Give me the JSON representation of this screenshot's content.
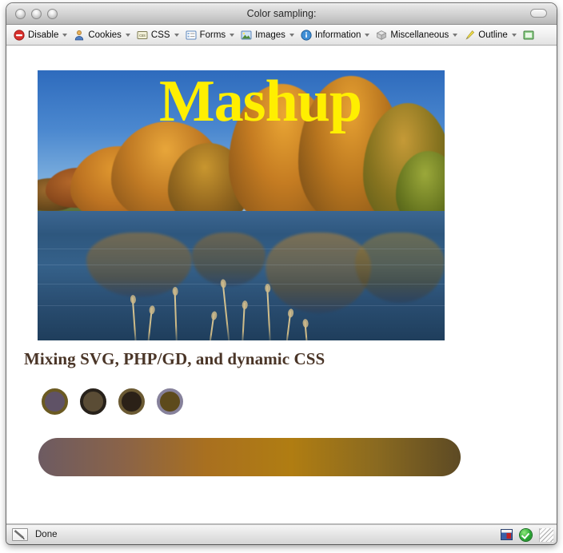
{
  "window": {
    "title": "Color sampling:",
    "traffic_lights": [
      "close-button",
      "minimize-button",
      "zoom-button"
    ],
    "toolbar_pill_name": "toolbar-toggle-pill"
  },
  "devbar": {
    "items": [
      {
        "label": "Disable",
        "icon": "disable-icon",
        "has_caret": true
      },
      {
        "label": "Cookies",
        "icon": "cookies-icon",
        "has_caret": true
      },
      {
        "label": "CSS",
        "icon": "css-icon",
        "has_caret": true
      },
      {
        "label": "Forms",
        "icon": "forms-icon",
        "has_caret": true
      },
      {
        "label": "Images",
        "icon": "images-icon",
        "has_caret": true
      },
      {
        "label": "Information",
        "icon": "information-icon",
        "has_caret": true
      },
      {
        "label": "Miscellaneous",
        "icon": "miscellaneous-icon",
        "has_caret": true
      },
      {
        "label": "Outline",
        "icon": "outline-icon",
        "has_caret": true
      },
      {
        "label": "",
        "icon": "resize-icon",
        "has_caret": false
      }
    ]
  },
  "page": {
    "banner_title": "Mashup",
    "banner_title_color": "#ffef00",
    "banner_alt": "autumn-trees-reflected-in-lake-photo",
    "subtitle": "Mixing SVG, PHP/GD, and dynamic CSS",
    "subtitle_color": "#4a3527",
    "swatches": [
      {
        "name": "swatch-1",
        "fill": "#5f5266",
        "border": "#6b5a22"
      },
      {
        "name": "swatch-2",
        "fill": "#5a4c35",
        "border": "#27211a"
      },
      {
        "name": "swatch-3",
        "fill": "#2b2117",
        "border": "#6b5a33"
      },
      {
        "name": "swatch-4",
        "fill": "#5d4a1c",
        "border": "#86819b"
      }
    ],
    "gradient_bar": {
      "name": "color-gradient-bar",
      "stops": [
        "#6d5b62",
        "#8a6348",
        "#a9701f",
        "#b07d12",
        "#8a6a20",
        "#5d4a24"
      ]
    }
  },
  "statusbar": {
    "text": "Done",
    "left_icon": "page-load-icon",
    "right_icons": [
      "window-mode-icon",
      "security-ok-icon",
      "resize-grip-icon"
    ]
  }
}
